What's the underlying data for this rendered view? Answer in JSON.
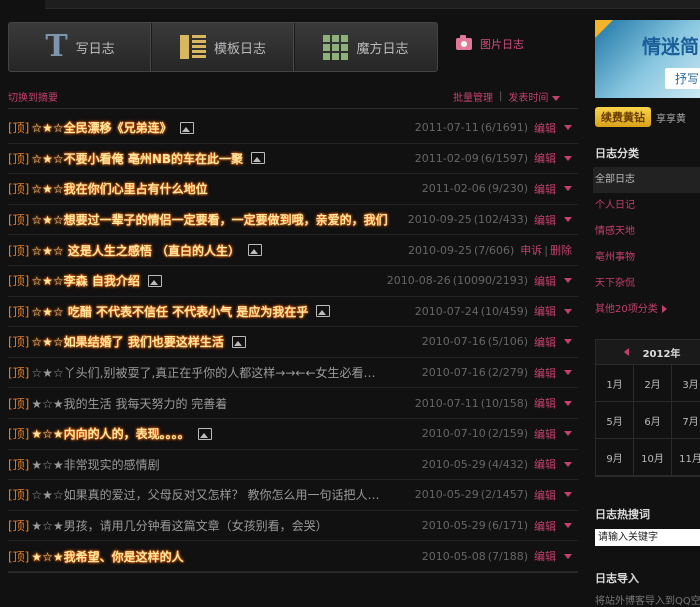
{
  "toolbar": {
    "write": "写日志",
    "template": "模板日志",
    "magic": "魔方日志",
    "photo": "图片日志"
  },
  "list_header": {
    "toggle": "切换到摘要",
    "batch": "批量管理",
    "sep": "|",
    "post_time": "发表时间"
  },
  "posts": [
    {
      "tag": "[顶]",
      "title": "☆★☆全民漂移《兄弟连》",
      "highlight": true,
      "has_pic": true,
      "date": "2011-07-11",
      "stats": "(6/1691)",
      "actions": [
        "编辑"
      ]
    },
    {
      "tag": "[顶]",
      "title": "☆★☆不要小看俺 亳州NB的车在此一聚",
      "highlight": true,
      "has_pic": true,
      "date": "2011-02-09",
      "stats": "(6/1597)",
      "actions": [
        "编辑"
      ]
    },
    {
      "tag": "[顶]",
      "title": "☆★☆我在你们心里占有什么地位",
      "highlight": true,
      "has_pic": false,
      "date": "2011-02-06",
      "stats": "(9/230)",
      "actions": [
        "编辑"
      ]
    },
    {
      "tag": "[顶]",
      "title": "☆★☆想要过一辈子的情侣一定要看，一定要做到哦，亲爱的，我们",
      "highlight": true,
      "has_pic": false,
      "date": "2010-09-25",
      "stats": "(102/433)",
      "actions": [
        "编辑"
      ]
    },
    {
      "tag": "[顶]",
      "title": "☆★☆ 这是人生之感悟 （直白的人生）",
      "highlight": true,
      "has_pic": true,
      "date": "2010-09-25",
      "stats": "(7/606)",
      "actions": [
        "申诉",
        "删除"
      ]
    },
    {
      "tag": "[顶]",
      "title": "☆★☆李森 自我介绍",
      "highlight": true,
      "has_pic": true,
      "date": "2010-08-26",
      "stats": "(10090/2193)",
      "actions": [
        "编辑"
      ]
    },
    {
      "tag": "[顶]",
      "title": "☆★☆ 吃醋 不代表不信任 不代表小气 是应为我在乎",
      "highlight": true,
      "has_pic": true,
      "date": "2010-07-24",
      "stats": "(10/459)",
      "actions": [
        "编辑"
      ]
    },
    {
      "tag": "[顶]",
      "title": "☆★☆如果结婚了 我们也要这样生活",
      "highlight": true,
      "has_pic": true,
      "date": "2010-07-16",
      "stats": "(5/106)",
      "actions": [
        "编辑"
      ]
    },
    {
      "tag": "[顶]",
      "title": "☆★☆丫头们,别被耍了,真正在乎你的人都这样→→←←女生必看…",
      "highlight": false,
      "has_pic": false,
      "date": "2010-07-16",
      "stats": "(2/279)",
      "actions": [
        "编辑"
      ]
    },
    {
      "tag": "[顶]",
      "title": "★☆★我的生活 我每天努力的 完善着",
      "highlight": false,
      "has_pic": false,
      "date": "2010-07-11",
      "stats": "(10/158)",
      "actions": [
        "编辑"
      ]
    },
    {
      "tag": "[顶]",
      "title": "★☆★内向的人的，表现。。。。",
      "highlight": true,
      "has_pic": true,
      "date": "2010-07-10",
      "stats": "(2/159)",
      "actions": [
        "编辑"
      ]
    },
    {
      "tag": "[顶]",
      "title": "★☆★非常现实的感情剧",
      "highlight": false,
      "has_pic": false,
      "date": "2010-05-29",
      "stats": "(4/432)",
      "actions": [
        "编辑"
      ]
    },
    {
      "tag": "[顶]",
      "title": "☆★☆如果真的爱过，父母反对又怎样？ 教你怎么用一句话把人…",
      "highlight": false,
      "has_pic": false,
      "date": "2010-05-29",
      "stats": "(2/1457)",
      "actions": [
        "编辑"
      ]
    },
    {
      "tag": "[顶]",
      "title": "★☆★男孩，请用几分钟看这篇文章（女孩别看，会哭）",
      "highlight": false,
      "has_pic": false,
      "date": "2010-05-29",
      "stats": "(6/171)",
      "actions": [
        "编辑"
      ]
    },
    {
      "tag": "[顶]",
      "title": "★☆★我希望、你是这样的人",
      "highlight": true,
      "has_pic": false,
      "date": "2010-05-08",
      "stats": "(7/188)",
      "actions": [
        "编辑"
      ]
    }
  ],
  "sidebar": {
    "banner_title": "情迷简",
    "banner_btn": "抒写",
    "vip_btn": "续费黄钻",
    "vip_text": "享享黄",
    "categories_title": "日志分类",
    "categories": [
      "全部日志",
      "个人日记",
      "情感天地",
      "亳州事物",
      "天下杂侃",
      "其他20项分类"
    ],
    "calendar_year": "2012年",
    "months": [
      "1月",
      "2月",
      "3月",
      "5月",
      "6月",
      "7月",
      "9月",
      "10月",
      "11月"
    ],
    "search_title": "日志热搜词",
    "search_placeholder": "请输入关键字",
    "import_title": "日志导入",
    "import_text": "将站外博客导入到QQ空"
  }
}
